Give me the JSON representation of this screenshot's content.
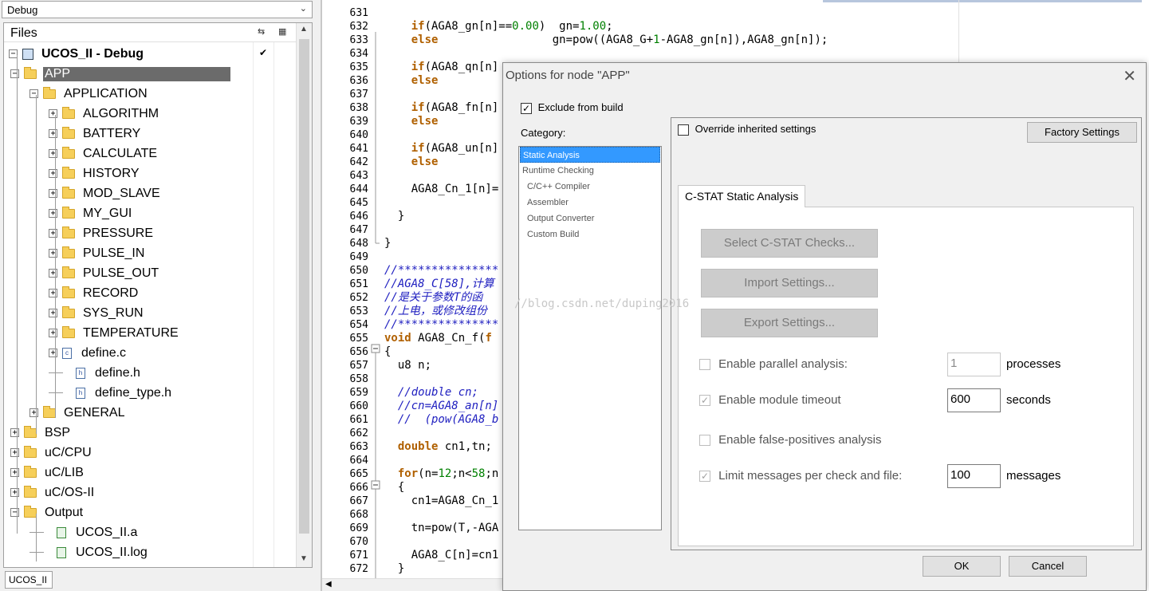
{
  "workspace": {
    "config": "Debug",
    "files_label": "Files",
    "project": "UCOS_II - Debug",
    "project_check": "✔",
    "bottom_tab": "UCOS_II",
    "tree": [
      {
        "label": "APP",
        "level": 1,
        "kind": "folder",
        "expander": "−"
      },
      {
        "label": "APPLICATION",
        "level": 2,
        "kind": "folder",
        "expander": "−"
      },
      {
        "label": "ALGORITHM",
        "level": 3,
        "kind": "folder",
        "expander": "+"
      },
      {
        "label": "BATTERY",
        "level": 3,
        "kind": "folder",
        "expander": "+"
      },
      {
        "label": "CALCULATE",
        "level": 3,
        "kind": "folder",
        "expander": "+"
      },
      {
        "label": "HISTORY",
        "level": 3,
        "kind": "folder",
        "expander": "+"
      },
      {
        "label": "MOD_SLAVE",
        "level": 3,
        "kind": "folder",
        "expander": "+"
      },
      {
        "label": "MY_GUI",
        "level": 3,
        "kind": "folder",
        "expander": "+"
      },
      {
        "label": "PRESSURE",
        "level": 3,
        "kind": "folder",
        "expander": "+"
      },
      {
        "label": "PULSE_IN",
        "level": 3,
        "kind": "folder",
        "expander": "+"
      },
      {
        "label": "PULSE_OUT",
        "level": 3,
        "kind": "folder",
        "expander": "+"
      },
      {
        "label": "RECORD",
        "level": 3,
        "kind": "folder",
        "expander": "+"
      },
      {
        "label": "SYS_RUN",
        "level": 3,
        "kind": "folder",
        "expander": "+"
      },
      {
        "label": "TEMPERATURE",
        "level": 3,
        "kind": "folder",
        "expander": "+"
      },
      {
        "label": "define.c",
        "level": 3,
        "kind": "cfile",
        "expander": "+"
      },
      {
        "label": "define.h",
        "level": 3,
        "kind": "hfile",
        "expander": ""
      },
      {
        "label": "define_type.h",
        "level": 3,
        "kind": "hfile",
        "expander": ""
      },
      {
        "label": "GENERAL",
        "level": 2,
        "kind": "folder",
        "expander": "+"
      },
      {
        "label": "BSP",
        "level": 1,
        "kind": "folder",
        "expander": "+"
      },
      {
        "label": "uC/CPU",
        "level": 1,
        "kind": "folder",
        "expander": "+"
      },
      {
        "label": "uC/LIB",
        "level": 1,
        "kind": "folder",
        "expander": "+"
      },
      {
        "label": "uC/OS-II",
        "level": 1,
        "kind": "folder",
        "expander": "+"
      },
      {
        "label": "Output",
        "level": 1,
        "kind": "folder",
        "expander": "−"
      },
      {
        "label": "UCOS_II.a",
        "level": 2,
        "kind": "outfile",
        "expander": ""
      },
      {
        "label": "UCOS_II.log",
        "level": 2,
        "kind": "outfile",
        "expander": ""
      }
    ]
  },
  "editor": {
    "watermark": "//blog.csdn.net/duping2016",
    "lines": [
      {
        "n": "631",
        "segs": [
          {
            "t": ""
          }
        ]
      },
      {
        "n": "632",
        "segs": [
          {
            "t": "    "
          },
          {
            "t": "if",
            "c": "kw"
          },
          {
            "t": "(AGA8_gn[n]=="
          },
          {
            "t": "0.00",
            "c": "num"
          },
          {
            "t": ")  gn="
          },
          {
            "t": "1.00",
            "c": "num"
          },
          {
            "t": ";"
          }
        ]
      },
      {
        "n": "633",
        "segs": [
          {
            "t": "    "
          },
          {
            "t": "else",
            "c": "kw"
          },
          {
            "t": "                 gn=pow((AGA8_G+"
          },
          {
            "t": "1",
            "c": "num"
          },
          {
            "t": "-AGA8_gn[n]),AGA8_gn[n]);"
          }
        ]
      },
      {
        "n": "634",
        "segs": [
          {
            "t": ""
          }
        ]
      },
      {
        "n": "635",
        "segs": [
          {
            "t": "    "
          },
          {
            "t": "if",
            "c": "kw"
          },
          {
            "t": "(AGA8_qn[n]"
          }
        ]
      },
      {
        "n": "636",
        "segs": [
          {
            "t": "    "
          },
          {
            "t": "else",
            "c": "kw"
          }
        ]
      },
      {
        "n": "637",
        "segs": [
          {
            "t": ""
          }
        ]
      },
      {
        "n": "638",
        "segs": [
          {
            "t": "    "
          },
          {
            "t": "if",
            "c": "kw"
          },
          {
            "t": "(AGA8_fn[n]"
          }
        ]
      },
      {
        "n": "639",
        "segs": [
          {
            "t": "    "
          },
          {
            "t": "else",
            "c": "kw"
          }
        ]
      },
      {
        "n": "640",
        "segs": [
          {
            "t": ""
          }
        ]
      },
      {
        "n": "641",
        "segs": [
          {
            "t": "    "
          },
          {
            "t": "if",
            "c": "kw"
          },
          {
            "t": "(AGA8_un[n]"
          }
        ]
      },
      {
        "n": "642",
        "segs": [
          {
            "t": "    "
          },
          {
            "t": "else",
            "c": "kw"
          }
        ]
      },
      {
        "n": "643",
        "segs": [
          {
            "t": ""
          }
        ]
      },
      {
        "n": "644",
        "segs": [
          {
            "t": "    AGA8_Cn_1[n]="
          }
        ]
      },
      {
        "n": "645",
        "segs": [
          {
            "t": ""
          }
        ]
      },
      {
        "n": "646",
        "segs": [
          {
            "t": "  }"
          }
        ]
      },
      {
        "n": "647",
        "segs": [
          {
            "t": ""
          }
        ]
      },
      {
        "n": "648",
        "segs": [
          {
            "t": "}"
          }
        ]
      },
      {
        "n": "649",
        "segs": [
          {
            "t": ""
          }
        ]
      },
      {
        "n": "650",
        "segs": [
          {
            "t": "//***************",
            "c": "cm"
          }
        ]
      },
      {
        "n": "651",
        "segs": [
          {
            "t": "//AGA8_C[58],计算",
            "c": "cm"
          }
        ]
      },
      {
        "n": "652",
        "segs": [
          {
            "t": "//是关于参数T的函",
            "c": "cm"
          }
        ]
      },
      {
        "n": "653",
        "segs": [
          {
            "t": "//上电，或修改组份",
            "c": "cm"
          }
        ]
      },
      {
        "n": "654",
        "segs": [
          {
            "t": "//***************",
            "c": "cm"
          }
        ]
      },
      {
        "n": "655",
        "segs": [
          {
            "t": "void",
            "c": "kw"
          },
          {
            "t": " AGA8_Cn_f("
          },
          {
            "t": "f",
            "c": "kw"
          }
        ]
      },
      {
        "n": "656",
        "segs": [
          {
            "t": "{"
          }
        ]
      },
      {
        "n": "657",
        "segs": [
          {
            "t": "  u8 n;"
          }
        ]
      },
      {
        "n": "658",
        "segs": [
          {
            "t": ""
          }
        ]
      },
      {
        "n": "659",
        "segs": [
          {
            "t": "  "
          },
          {
            "t": "//double cn;",
            "c": "cm"
          }
        ]
      },
      {
        "n": "660",
        "segs": [
          {
            "t": "  "
          },
          {
            "t": "//cn=AGA8_an[n]",
            "c": "cm"
          }
        ]
      },
      {
        "n": "661",
        "segs": [
          {
            "t": "  "
          },
          {
            "t": "//  (pow(AGA8_b",
            "c": "cm"
          }
        ]
      },
      {
        "n": "662",
        "segs": [
          {
            "t": ""
          }
        ]
      },
      {
        "n": "663",
        "segs": [
          {
            "t": "  "
          },
          {
            "t": "double",
            "c": "kw"
          },
          {
            "t": " cn1,tn;"
          }
        ]
      },
      {
        "n": "664",
        "segs": [
          {
            "t": ""
          }
        ]
      },
      {
        "n": "665",
        "segs": [
          {
            "t": "  "
          },
          {
            "t": "for",
            "c": "kw"
          },
          {
            "t": "(n="
          },
          {
            "t": "12",
            "c": "num"
          },
          {
            "t": ";n<"
          },
          {
            "t": "58",
            "c": "num"
          },
          {
            "t": ";n"
          }
        ]
      },
      {
        "n": "666",
        "segs": [
          {
            "t": "  {"
          }
        ]
      },
      {
        "n": "667",
        "segs": [
          {
            "t": "    cn1=AGA8_Cn_1"
          }
        ]
      },
      {
        "n": "668",
        "segs": [
          {
            "t": ""
          }
        ]
      },
      {
        "n": "669",
        "segs": [
          {
            "t": "    tn=pow(T,-AGA"
          }
        ]
      },
      {
        "n": "670",
        "segs": [
          {
            "t": ""
          }
        ]
      },
      {
        "n": "671",
        "segs": [
          {
            "t": "    AGA8_C[n]=cn1"
          }
        ]
      },
      {
        "n": "672",
        "segs": [
          {
            "t": "  }"
          }
        ]
      }
    ]
  },
  "dialog": {
    "title": "Options for node \"APP\"",
    "close": "✕",
    "exclude_label": "Exclude from build",
    "exclude_checked": true,
    "category_label": "Category:",
    "categories": [
      {
        "label": "Static Analysis",
        "selected": true,
        "sub": false
      },
      {
        "label": "Runtime Checking",
        "selected": false,
        "sub": false
      },
      {
        "label": "C/C++ Compiler",
        "selected": false,
        "sub": true
      },
      {
        "label": "Assembler",
        "selected": false,
        "sub": true
      },
      {
        "label": "Output Converter",
        "selected": false,
        "sub": true
      },
      {
        "label": "Custom Build",
        "selected": false,
        "sub": true
      }
    ],
    "override_label": "Override inherited settings",
    "factory_button": "Factory Settings",
    "tab_label": "C-STAT Static Analysis",
    "select_checks_button": "Select C-STAT Checks...",
    "import_button": "Import Settings...",
    "export_button": "Export Settings...",
    "options": {
      "parallel": {
        "label": "Enable parallel analysis:",
        "checked": false,
        "value": "1",
        "unit": "processes"
      },
      "timeout": {
        "label": "Enable module timeout",
        "checked": true,
        "value": "600",
        "unit": "seconds"
      },
      "false_positives": {
        "label": "Enable false-positives analysis",
        "checked": false
      },
      "limit": {
        "label": "Limit messages per check and file:",
        "checked": true,
        "value": "100",
        "unit": "messages"
      }
    },
    "ok_button": "OK",
    "cancel_button": "Cancel"
  }
}
